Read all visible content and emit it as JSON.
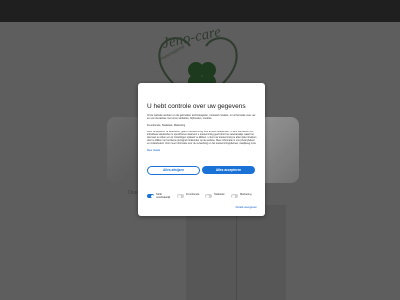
{
  "background": {
    "logo_text": "Jeno-care",
    "logo_sub": "Thuiszorggroep",
    "ghost_text": "Ons..."
  },
  "consent": {
    "title": "U hebt controle over uw gegevens",
    "intro": "Onze website werken en de gebruiken technologieën, inclusief cookies, om informatie over uw en uw interacties met onze websites, bijhouden, cookies",
    "links_line": "Functionele, Statistiek, Marketing",
    "body": "Door 'accepteren' te selecteren, geeft u toestemming voor al deze doeleinden. U kunt ook kiezen om individuele doeleinden te specificeren waarvoor u toestemming geeft door het selectievakje naast het doel aan te vinken en op 'instellingen opslaan' te klikken. U kunt uw toestemming te allen tijde intrekken door te klikken op het kleine pictogram linksonder op de website. Meer informatie in ons privacybeleid en cookiebeleid. Voor meer informatie over de verwerking en het toestemmingsbeheer, raadpleeg onze",
    "extra_link": "Meer details",
    "reject_label": "Alles afwijzen",
    "accept_label": "Alles accepteren",
    "toggles": [
      {
        "label": "Strikt noodzakelijk",
        "on": true
      },
      {
        "label": "Functionele",
        "on": false
      },
      {
        "label": "Statistiek",
        "on": false
      },
      {
        "label": "Marketing",
        "on": false
      }
    ],
    "details_link": "Details weergeven"
  },
  "colors": {
    "accent": "#1b72d6",
    "overlay": "#5e5e5e",
    "topbar": "#1f1f1f"
  }
}
